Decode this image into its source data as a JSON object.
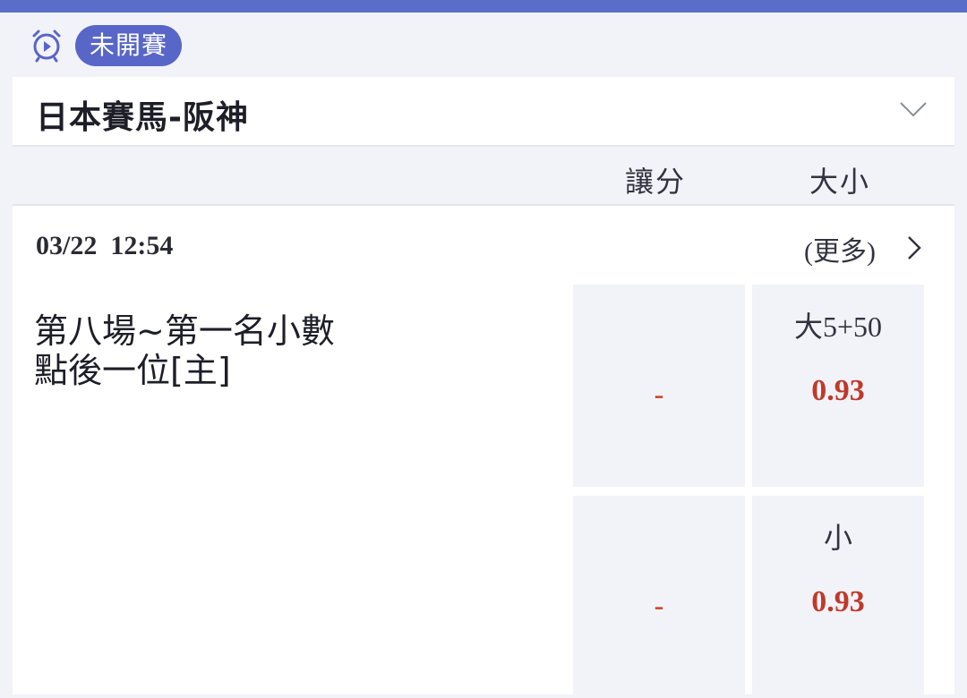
{
  "status": {
    "label": "未開賽"
  },
  "league": {
    "name": "日本賽馬-阪神"
  },
  "columns": {
    "spread": "讓分",
    "total": "大小"
  },
  "match": {
    "datetime": "03/22  12:54",
    "more": "(更多)",
    "bet_name_line1": "第八場~第一名小數",
    "bet_name_line2": "點後一位[主]",
    "rows": [
      {
        "spread": "-",
        "total_label": "大5+50",
        "total_odds": "0.93"
      },
      {
        "spread": "-",
        "total_label": "小",
        "total_odds": "0.93"
      }
    ]
  },
  "colors": {
    "accent": "#5866c8",
    "odds": "#c0392b",
    "cell_bg": "#f2f3f8"
  }
}
